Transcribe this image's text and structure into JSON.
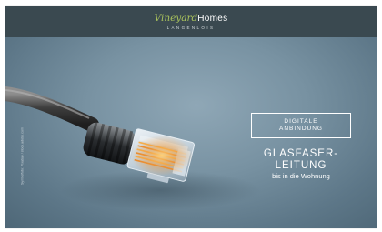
{
  "brand": {
    "name_script": "Vineyard",
    "name_caps": "Homes",
    "location": "LANGENLOIS"
  },
  "hero": {
    "image": "network-cable-rj45-connector",
    "photo_credit": "Symbolfoto: Pixabay / stock.adobe.com",
    "badge_lines": [
      "DIGITALE",
      "ANBINDUNG"
    ],
    "headline_lines": [
      "GLASFASER-",
      "LEITUNG"
    ],
    "subline": "bis in die Wohnung"
  },
  "colors": {
    "header_bg": "#3a4950",
    "brand_accent": "#a9c25c",
    "hero_bg": "#7892a2",
    "text": "#ffffff"
  }
}
